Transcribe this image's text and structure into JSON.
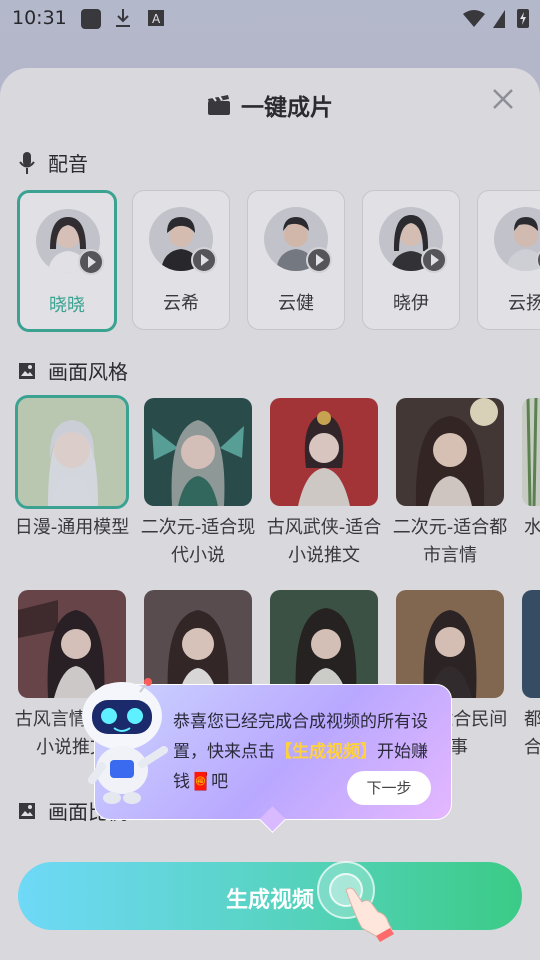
{
  "status_bar": {
    "time": "10:31"
  },
  "sheet": {
    "title": "一键成片",
    "voice_section": {
      "title": "配音"
    },
    "voices": [
      {
        "name": "晓晓",
        "selected": true
      },
      {
        "name": "云希",
        "selected": false
      },
      {
        "name": "云健",
        "selected": false
      },
      {
        "name": "晓伊",
        "selected": false
      },
      {
        "name": "云扬",
        "selected": false
      }
    ],
    "style_section": {
      "title": "画面风格"
    },
    "styles_row1": [
      {
        "label": "日漫-通用模型",
        "selected": true
      },
      {
        "label": "二次元-适合现代小说",
        "selected": false
      },
      {
        "label": "古风武侠-适合小说推文",
        "selected": false
      },
      {
        "label": "二次元-适合都市言情",
        "selected": false
      },
      {
        "label": "水",
        "selected": false
      }
    ],
    "styles_row2": [
      {
        "label": "古风言情-适合小说推文"
      },
      {
        "label": ""
      },
      {
        "label": ""
      },
      {
        "label": "古风-适合民间故事"
      },
      {
        "label": "都合"
      }
    ],
    "ratio_section": {
      "title": "画面比例"
    }
  },
  "tooltip": {
    "message_before": "恭喜您已经完成合成视频的所有设置，快来点击",
    "highlight": "【生成视频】",
    "message_after": "开始赚钱🧧吧",
    "next_label": "下一步"
  },
  "generate_button": {
    "label": "生成视频"
  },
  "colors": {
    "accent": "#35b39a",
    "button_start": "#6fd9f7",
    "button_end": "#3bcb86",
    "highlight": "#ffd23c"
  }
}
